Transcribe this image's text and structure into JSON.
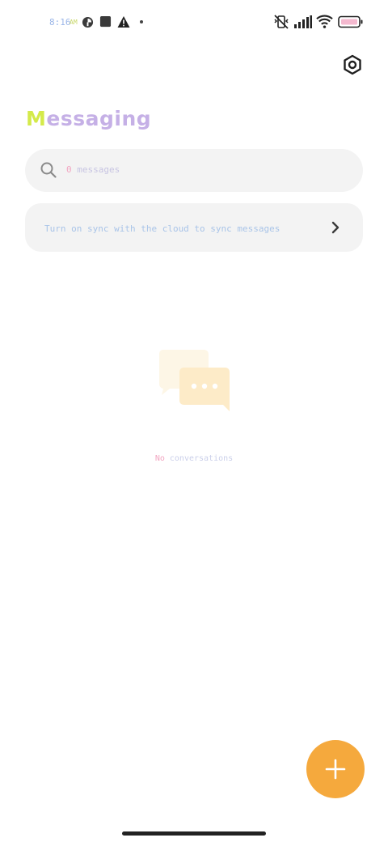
{
  "status_bar": {
    "time": "8:16",
    "ampm": "AM",
    "icons": [
      "notification-app-icon",
      "square-notification-icon",
      "warning-icon",
      "more-dot-icon",
      "mute-vibrate-icon",
      "signal-icon",
      "wifi-icon",
      "battery-icon"
    ]
  },
  "header": {
    "title_first": "M",
    "title_rest": "essaging",
    "settings_icon": "settings-hexagon-icon"
  },
  "search": {
    "count": "0",
    "placeholder_rest": " messages",
    "icon": "search-icon"
  },
  "sync_banner": {
    "text": "Turn on sync with the cloud to sync messages",
    "chevron_icon": "chevron-right-icon"
  },
  "empty_state": {
    "illustration": "chat-bubbles-icon",
    "text_first": "No",
    "text_rest": " conversations"
  },
  "fab": {
    "icon": "plus-icon"
  },
  "colors": {
    "accent": "#f5a93d",
    "surface": "#f3f3f3",
    "title_lavender": "#c5b0e6",
    "title_lime": "#d4ea4a",
    "text_pink": "#f2a6c2",
    "text_blue": "#a9c4e8"
  }
}
